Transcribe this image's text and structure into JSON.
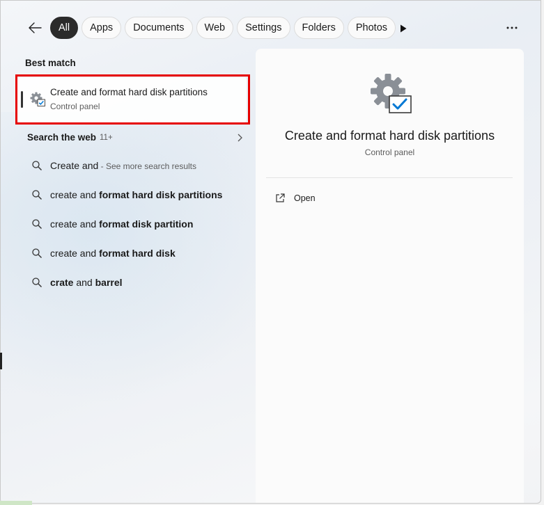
{
  "topbar": {
    "filters": [
      {
        "label": "All",
        "active": true
      },
      {
        "label": "Apps",
        "active": false
      },
      {
        "label": "Documents",
        "active": false
      },
      {
        "label": "Web",
        "active": false
      },
      {
        "label": "Settings",
        "active": false
      },
      {
        "label": "Folders",
        "active": false
      },
      {
        "label": "Photos",
        "active": false
      }
    ],
    "more": "•••"
  },
  "best_match": {
    "heading": "Best match",
    "title": "Create and format hard disk partitions",
    "subtitle": "Control panel"
  },
  "web": {
    "heading": "Search the web",
    "count": "11+",
    "suggestions": [
      {
        "normal": "Create and",
        "bold": "",
        "hint": " - See more search results"
      },
      {
        "normal": "create and ",
        "bold": "format hard disk partitions",
        "hint": ""
      },
      {
        "normal": "create and ",
        "bold": "format disk partition",
        "hint": ""
      },
      {
        "normal": "create and ",
        "bold": "format hard disk",
        "hint": ""
      },
      {
        "prefix_bold": "crate",
        "normal": " and ",
        "bold": "barrel",
        "hint": ""
      }
    ]
  },
  "preview": {
    "title": "Create and format hard disk partitions",
    "subtitle": "Control panel",
    "actions": [
      {
        "label": "Open",
        "icon": "open-external-icon"
      }
    ]
  },
  "colors": {
    "accent": "#0078d4",
    "highlight": "#e60000",
    "chip_active": "#2b2b2b"
  }
}
